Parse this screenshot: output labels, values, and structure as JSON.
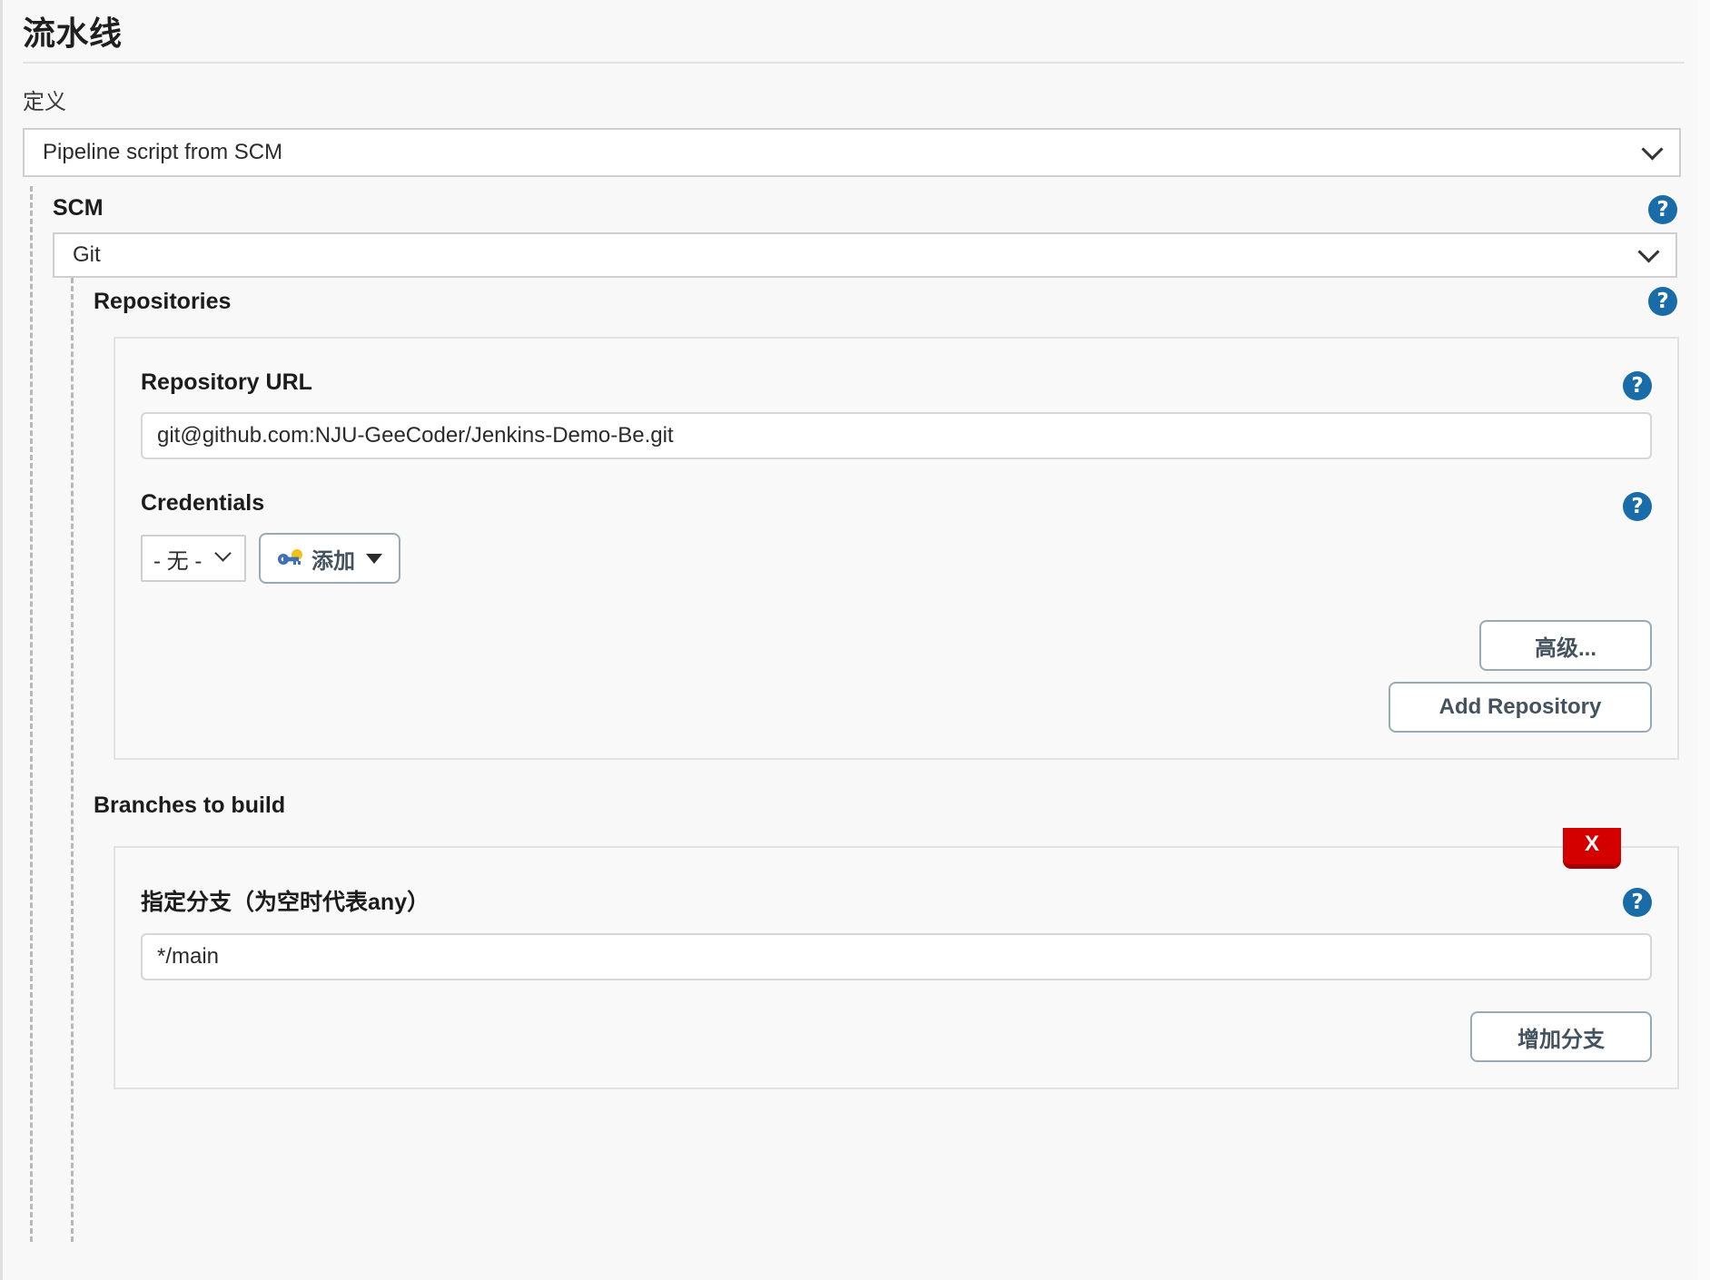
{
  "header": {
    "title": "流水线"
  },
  "definition": {
    "label": "定义",
    "selected": "Pipeline script from SCM",
    "chevron_icon": "chevron-down-icon"
  },
  "scm": {
    "label": "SCM",
    "selected": "Git",
    "help_icon": "help-icon"
  },
  "repositories": {
    "label": "Repositories",
    "help_icon": "help-icon",
    "repository_url": {
      "label": "Repository URL",
      "value": "git@github.com:NJU-GeeCoder/Jenkins-Demo-Be.git",
      "help_icon": "help-icon"
    },
    "credentials": {
      "label": "Credentials",
      "selected": "- 无 -",
      "add_button_label": "添加",
      "add_button_icon": "key-icon",
      "add_button_caret": "caret-down-icon",
      "help_icon": "help-icon"
    },
    "advanced_button_label": "高级...",
    "add_repository_button_label": "Add Repository"
  },
  "branches": {
    "label": "Branches to build",
    "specifier": {
      "label_prefix": "指定分支（为空时代表",
      "label_bold": "any",
      "label_suffix": "）",
      "value": "*/main",
      "help_icon": "help-icon"
    },
    "delete_button_label": "X",
    "add_branch_button_label": "增加分支"
  },
  "colors": {
    "help_blue": "#1a6ca8",
    "delete_red": "#d40000",
    "delete_red_dark": "#a50000",
    "button_border": "#9aaab5",
    "button_text": "#43525e",
    "page_bg": "#f8f8f8"
  }
}
